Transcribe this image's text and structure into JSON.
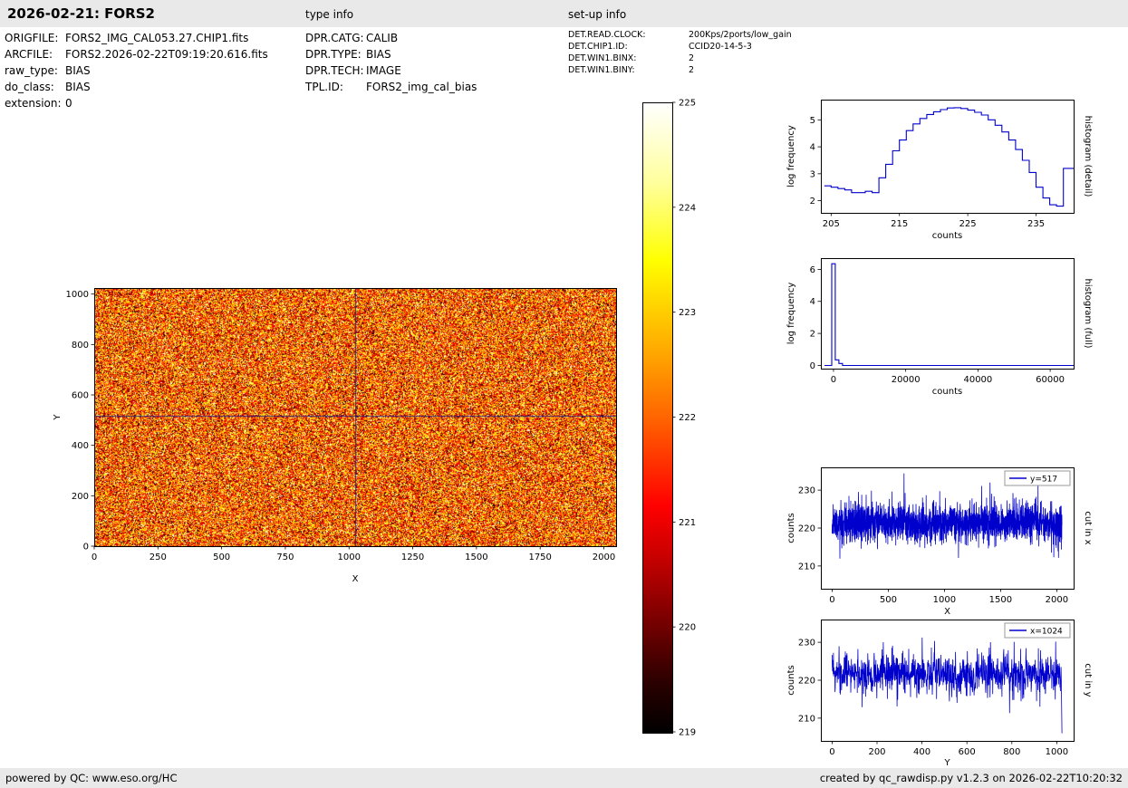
{
  "header": {
    "title": "2026-02-21: FORS2",
    "type_info_title": "type info",
    "setup_info_title": "set-up info"
  },
  "file_info": {
    "rows": [
      {
        "label": "ORIGFILE:",
        "value": "FORS2_IMG_CAL053.27.CHIP1.fits"
      },
      {
        "label": "ARCFILE:",
        "value": "FORS2.2026-02-22T09:19:20.616.fits"
      },
      {
        "label": "raw_type:",
        "value": "BIAS"
      },
      {
        "label": "do_class:",
        "value": "BIAS"
      },
      {
        "label": "extension:",
        "value": "0"
      }
    ]
  },
  "type_info": {
    "rows": [
      {
        "label": "DPR.CATG:",
        "value": "CALIB"
      },
      {
        "label": "DPR.TYPE:",
        "value": "BIAS"
      },
      {
        "label": "DPR.TECH:",
        "value": "IMAGE"
      },
      {
        "label": "TPL.ID:",
        "value": "FORS2_img_cal_bias"
      }
    ]
  },
  "setup_info": {
    "rows": [
      {
        "label": "DET.READ.CLOCK:",
        "value": "200Kps/2ports/low_gain"
      },
      {
        "label": "DET.CHIP1.ID:",
        "value": "CCID20-14-5-3"
      },
      {
        "label": "DET.WIN1.BINX:",
        "value": "2"
      },
      {
        "label": "DET.WIN1.BINY:",
        "value": "2"
      }
    ]
  },
  "footer": {
    "left": "powered by QC: www.eso.org/HC",
    "right": "created by qc_rawdisp.py v1.2.3 on 2026-02-22T10:20:32"
  },
  "colors": {
    "line_blue": "#0000cd",
    "header_bg": "#e9e9e9",
    "crosshair": "#14148c"
  },
  "chart_data": [
    {
      "id": "bias_image",
      "type": "heatmap",
      "title": "",
      "xlabel": "X",
      "ylabel": "Y",
      "xlim": [
        0,
        2048
      ],
      "ylim": [
        0,
        1024
      ],
      "x_ticks": [
        0,
        250,
        500,
        750,
        1000,
        1250,
        1500,
        1750,
        2000
      ],
      "y_ticks": [
        0,
        200,
        400,
        600,
        800,
        1000
      ],
      "colormap": "hot",
      "value_range": [
        219,
        225
      ],
      "noise": {
        "mean": 222,
        "min": 219,
        "max": 225,
        "seed": 42
      },
      "crosshair": {
        "x": 1024,
        "y": 517
      }
    },
    {
      "id": "colorbar",
      "type": "colorbar",
      "colormap": "hot",
      "ticks": [
        219,
        220,
        221,
        222,
        223,
        224,
        225
      ]
    },
    {
      "id": "histogram_detail",
      "type": "line",
      "series_type": "step",
      "xlabel": "counts",
      "ylabel": "log frequency",
      "side_label": "histogram (detail)",
      "xlim": [
        203.5,
        240.5
      ],
      "ylim": [
        1.55,
        5.75
      ],
      "x_ticks": [
        205,
        215,
        225,
        235
      ],
      "y_ticks": [
        2,
        3,
        4,
        5
      ],
      "x": [
        204,
        205,
        206,
        207,
        208,
        209,
        210,
        211,
        212,
        213,
        214,
        215,
        216,
        217,
        218,
        219,
        220,
        221,
        222,
        223,
        224,
        225,
        226,
        227,
        228,
        229,
        230,
        231,
        232,
        233,
        234,
        235,
        236,
        237,
        238,
        239
      ],
      "y": [
        2.55,
        2.5,
        2.45,
        2.4,
        2.3,
        2.3,
        2.35,
        2.3,
        2.85,
        3.35,
        3.85,
        4.25,
        4.6,
        4.85,
        5.05,
        5.2,
        5.3,
        5.38,
        5.44,
        5.45,
        5.42,
        5.36,
        5.28,
        5.18,
        5.0,
        4.8,
        4.55,
        4.25,
        3.9,
        3.5,
        3.05,
        2.5,
        2.1,
        1.85,
        1.8,
        3.2
      ]
    },
    {
      "id": "histogram_full",
      "type": "line",
      "series_type": "step",
      "xlabel": "counts",
      "ylabel": "log frequency",
      "side_label": "histogram (full)",
      "xlim": [
        -3500,
        66500
      ],
      "ylim": [
        -0.2,
        6.7
      ],
      "x_ticks": [
        0,
        20000,
        40000,
        60000
      ],
      "y_ticks": [
        0,
        2,
        4,
        6
      ],
      "x": [
        -2500,
        -1500,
        -500,
        500,
        1500,
        2500,
        65500
      ],
      "y": [
        0,
        0,
        6.35,
        0.35,
        0.12,
        0,
        0
      ]
    },
    {
      "id": "cut_x",
      "type": "line",
      "series_type": "noise_line",
      "xlabel": "X",
      "ylabel": "counts",
      "side_label": "cut in x",
      "legend": "y=517",
      "xlim": [
        -100,
        2150
      ],
      "ylim": [
        204,
        236
      ],
      "x_ticks": [
        0,
        500,
        1000,
        1500,
        2000
      ],
      "y_ticks": [
        210,
        220,
        230
      ],
      "noise": {
        "n": 2048,
        "mean": 221.5,
        "std": 2.6,
        "seed": 11,
        "spike_prob": 0.008,
        "spike_amp": 7
      }
    },
    {
      "id": "cut_y",
      "type": "line",
      "series_type": "noise_line",
      "xlabel": "Y",
      "ylabel": "counts",
      "side_label": "cut in y",
      "legend": "x=1024",
      "xlim": [
        -50,
        1075
      ],
      "ylim": [
        204,
        236
      ],
      "x_ticks": [
        0,
        200,
        400,
        600,
        800,
        1000
      ],
      "y_ticks": [
        210,
        220,
        230
      ],
      "noise": {
        "n": 1024,
        "mean": 221.5,
        "std": 2.6,
        "seed": 23,
        "spike_prob": 0.008,
        "spike_amp": 7,
        "end_values": [
          216,
          210,
          206
        ]
      }
    }
  ]
}
